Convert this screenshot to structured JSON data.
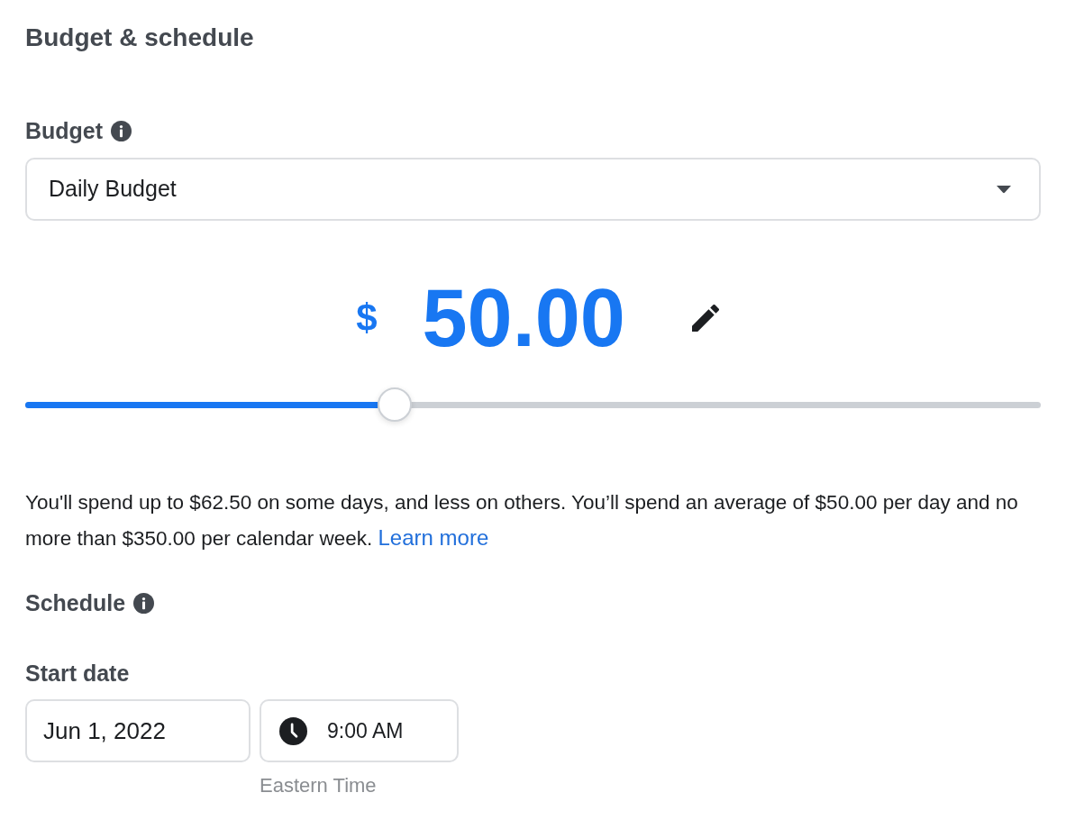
{
  "section_title": "Budget & schedule",
  "budget": {
    "label": "Budget",
    "dropdown": {
      "value": "Daily Budget"
    },
    "currency": "$",
    "amount": "50.00",
    "slider": {
      "level": 0.364
    },
    "note": "You'll spend up to $62.50 on some days, and less on others. You’ll spend an average of $50.00 per day and no more than $350.00 per calendar week.",
    "link": "Learn more"
  },
  "schedule": {
    "label": "Schedule",
    "start_date": {
      "label": "Start date",
      "date": "Jun 1, 2022",
      "time": "9:00 AM",
      "timezone": "Eastern Time"
    }
  }
}
